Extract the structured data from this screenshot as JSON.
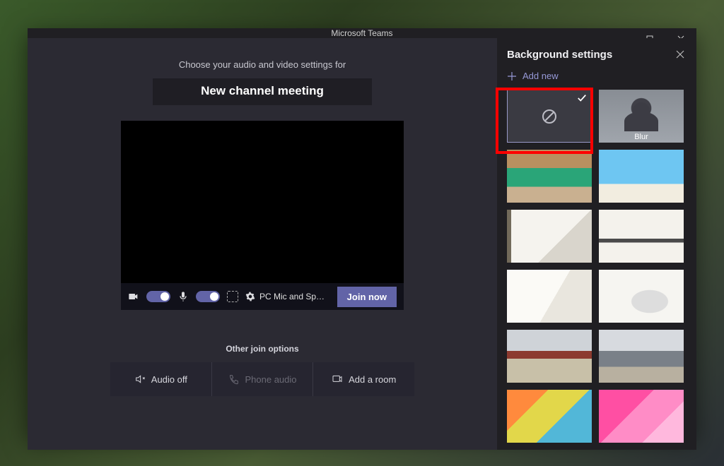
{
  "window": {
    "title": "Microsoft Teams"
  },
  "join": {
    "prompt": "Choose your audio and video settings for",
    "meeting_title": "New channel meeting",
    "camera_on": true,
    "mic_on": true,
    "device_label": "PC Mic and Sp…",
    "join_button": "Join now",
    "other_options_label": "Other join options",
    "options": {
      "audio_off": "Audio off",
      "phone_audio": "Phone audio",
      "add_room": "Add a room"
    }
  },
  "bg_panel": {
    "title": "Background settings",
    "add_new": "Add new",
    "tiles": {
      "none": {
        "selected": true
      },
      "blur": {
        "label": "Blur"
      }
    }
  },
  "colors": {
    "accent": "#6264a7",
    "highlight": "#ff0000"
  }
}
